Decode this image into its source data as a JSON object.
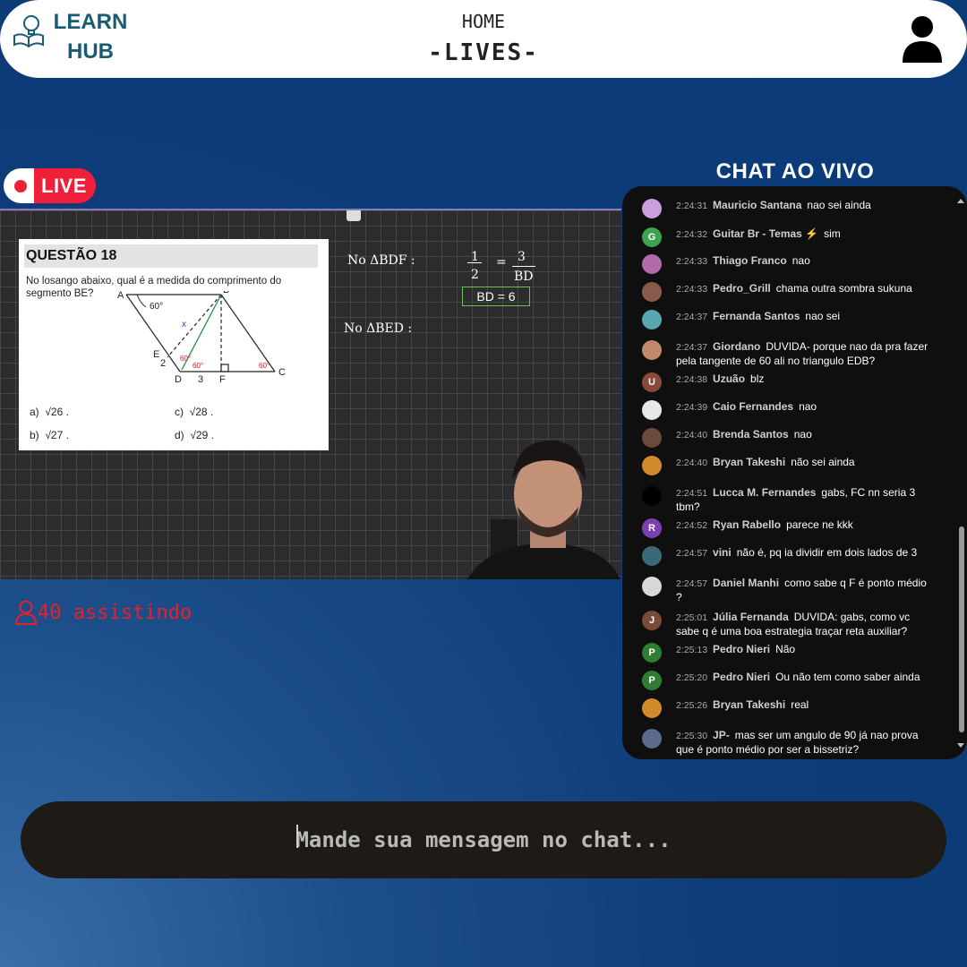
{
  "header": {
    "logo_line1": "LEARN",
    "logo_line2": "HUB",
    "nav_home": "HOME",
    "nav_lives": "-LIVES-"
  },
  "live_badge": "LIVE",
  "video": {
    "question_title": "QUESTÃO 18",
    "question_text": "No losango abaixo, qual é a medida do comprimento do segmento BE?",
    "figure": {
      "labels": [
        "A",
        "B",
        "E",
        "D",
        "F",
        "C",
        "60°",
        "2",
        "3"
      ]
    },
    "options": [
      {
        "letter": "a)",
        "value": "√26 ."
      },
      {
        "letter": "c)",
        "value": "√28 ."
      },
      {
        "letter": "b)",
        "value": "√27 ."
      },
      {
        "letter": "d)",
        "value": "√29 ."
      }
    ],
    "board": {
      "note1": "No ΔBDF :",
      "fraction_left_num": "1",
      "fraction_left_den": "2",
      "equals": "=",
      "fraction_right_num": "3",
      "fraction_right_den": "BD",
      "result": "BD = 6",
      "note2": "No ΔBED :"
    }
  },
  "viewers": "40 assistindo",
  "chat": {
    "title": "CHAT AO VIVO",
    "messages": [
      {
        "time": "2:24:31",
        "name": "Mauricio Santana",
        "text": "nao sei ainda",
        "avatar": "",
        "color": "#c9a0dc"
      },
      {
        "time": "2:24:32",
        "name": "Guitar Br - Temas ⚡",
        "text": "sim",
        "avatar": "G",
        "color": "#3fa34d"
      },
      {
        "time": "2:24:33",
        "name": "Thiago Franco",
        "text": "nao",
        "avatar": "",
        "color": "#b06aa8"
      },
      {
        "time": "2:24:33",
        "name": "Pedro_Grill",
        "text": "chama outra sombra sukuna",
        "avatar": "",
        "color": "#8a5a4a"
      },
      {
        "time": "2:24:37",
        "name": "Fernanda Santos",
        "text": "nao sei",
        "avatar": "",
        "color": "#5aa6b0"
      },
      {
        "time": "2:24:37",
        "name": "Giordano",
        "text": "DUVIDA- porque nao da pra fazer pela tangente de 60 ali no triangulo EDB?",
        "avatar": "",
        "color": "#c08a6a"
      },
      {
        "time": "2:24:38",
        "name": "Uzuão",
        "text": "blz",
        "avatar": "U",
        "color": "#8a4a3a"
      },
      {
        "time": "2:24:39",
        "name": "Caio Fernandes",
        "text": "nao",
        "avatar": "",
        "color": "#e8e8e8"
      },
      {
        "time": "2:24:40",
        "name": "Brenda Santos",
        "text": "nao",
        "avatar": "",
        "color": "#6a4a3a"
      },
      {
        "time": "2:24:40",
        "name": "Bryan Takeshi",
        "text": "não sei ainda",
        "avatar": "",
        "color": "#d08a2a"
      },
      {
        "time": "2:24:51",
        "name": "Lucca M. Fernandes",
        "text": "gabs, FC nn seria 3 tbm?",
        "avatar": "",
        "color": "#000000"
      },
      {
        "time": "2:24:52",
        "name": "Ryan Rabello",
        "text": "parece ne kkk",
        "avatar": "R",
        "color": "#7b3fb0"
      },
      {
        "time": "2:24:57",
        "name": "vini",
        "text": "não é, pq ia dividir em dois lados de 3",
        "avatar": "",
        "color": "#3a6a7a"
      },
      {
        "time": "2:24:57",
        "name": "Daniel Manhi",
        "text": "como sabe q F é ponto médio ?",
        "avatar": "",
        "color": "#d8d8d8"
      },
      {
        "time": "2:25:01",
        "name": "Júlia Fernanda",
        "text": "DUVIDA: gabs, como vc sabe q é uma boa estrategia traçar reta auxiliar?",
        "avatar": "J",
        "color": "#7a4a3a"
      },
      {
        "time": "2:25:13",
        "name": "Pedro Nieri",
        "text": "Não",
        "avatar": "P",
        "color": "#2e7d32"
      },
      {
        "time": "2:25:20",
        "name": "Pedro Nieri",
        "text": "Ou não tem como saber ainda",
        "avatar": "P",
        "color": "#2e7d32"
      },
      {
        "time": "2:25:26",
        "name": "Bryan Takeshi",
        "text": "real",
        "avatar": "",
        "color": "#d08a2a"
      },
      {
        "time": "2:25:30",
        "name": "JP-",
        "text": "mas ser um angulo de 90 já nao prova que é ponto médio por ser a bissetriz?",
        "avatar": "",
        "color": "#5a6a8a"
      }
    ]
  },
  "input": {
    "placeholder": "Mande sua mensagem no chat..."
  }
}
